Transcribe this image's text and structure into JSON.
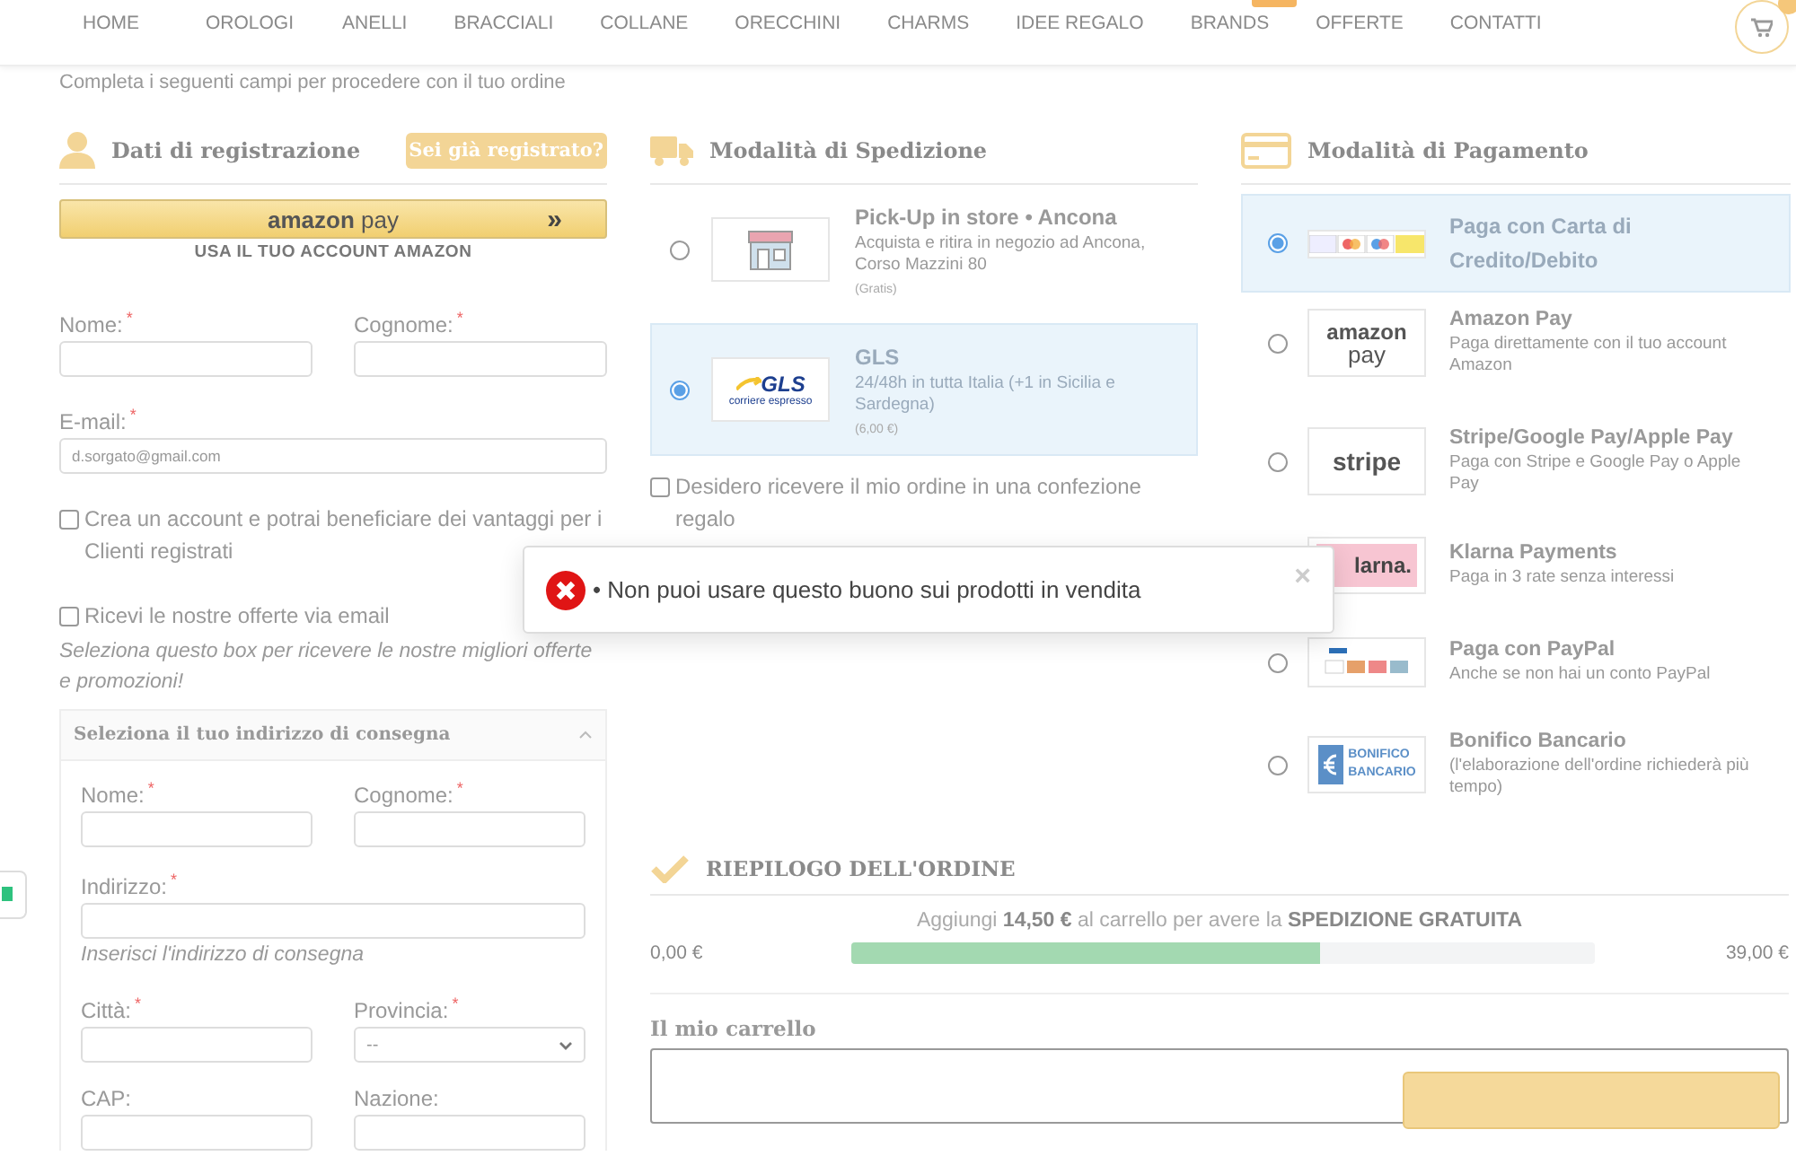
{
  "nav": {
    "items": [
      "HOME",
      "OROLOGI",
      "ANELLI",
      "BRACCIALI",
      "COLLANE",
      "ORECCHINI",
      "CHARMS",
      "IDEE REGALO",
      "BRANDS",
      "OFFERTE",
      "CONTATTI"
    ]
  },
  "intro": "Completa i seguenti campi per procedere con il tuo ordine",
  "registration": {
    "title": "Dati di registrazione",
    "login_button": "Sei già registrato?",
    "amazon_pay": {
      "logo": [
        "amazon",
        "pay"
      ],
      "arrow": "»",
      "caption": "USA IL TUO ACCOUNT AMAZON"
    },
    "rows": [
      [
        {
          "label": "Nome:",
          "mark": "*"
        },
        {
          "label": "Cognome:",
          "mark": "*"
        }
      ],
      [
        {
          "label": "E-mail:",
          "mark": "*",
          "value": "d.sorgato@gmail.com"
        }
      ]
    ],
    "options": [
      {
        "label": "Crea un account e potrai beneficiare dei vantaggi per i Clienti registrati",
        "checked": false
      },
      {
        "label": "Ricevi le nostre offerte via email",
        "checked": false,
        "hint": "Seleziona questo box per ricevere le nostre migliori offerte e promozioni!"
      }
    ]
  },
  "address": {
    "title": "Seleziona il tuo indirizzo di consegna",
    "expanded": true,
    "rows": [
      [
        {
          "label": "Nome:",
          "mark": "*"
        },
        {
          "label": "Cognome:",
          "mark": "*"
        }
      ],
      [
        {
          "label": "Indirizzo:",
          "mark": "*",
          "hint": "Inserisci l'indirizzo di consegna"
        }
      ],
      [
        {
          "label": "Città:",
          "mark": "*"
        },
        {
          "label": "Provincia:",
          "mark": "*",
          "kind": "select",
          "value": "--"
        }
      ],
      [
        {
          "label": "CAP:"
        },
        {
          "label": "Nazione:"
        }
      ]
    ]
  },
  "shipping": {
    "title": "Modalità di Spedizione",
    "options": [
      {
        "kind": "store",
        "name": "Pick-Up in store • Ancona",
        "description": "Acquista e ritira in negozio ad Ancona, Corso Mazzini 80",
        "price": "(Gratis)",
        "selected": false
      },
      {
        "kind": "gls",
        "logo_text": [
          "GLS",
          "corriere espresso"
        ],
        "name": "GLS",
        "description": "24/48h in tutta Italia (+1 in Sicilia e Sardegna)",
        "price": "(6,00 €)",
        "selected": true
      }
    ],
    "gift": {
      "label": "Desidero ricevere il mio ordine in una confezione regalo",
      "checked": false
    }
  },
  "payment": {
    "title": "Modalità di Pagamento",
    "options": [
      {
        "kind": "cards",
        "name": "Paga con Carta di Credito/Debito",
        "selected": true
      },
      {
        "kind": "amazon",
        "logo_text": [
          "amazon",
          "pay"
        ],
        "name": "Amazon Pay",
        "description": "Paga direttamente con il tuo account Amazon",
        "selected": false
      },
      {
        "kind": "stripe",
        "logo_text": [
          "stripe"
        ],
        "name": "Stripe/Google Pay/Apple Pay",
        "description": "Paga con Stripe e Google Pay o Apple Pay",
        "selected": false
      },
      {
        "kind": "klarna",
        "logo_text": [
          "larna."
        ],
        "name": "Klarna Payments",
        "description": "Paga in 3 rate senza interessi"
      },
      {
        "kind": "paypal",
        "name": "Paga con PayPal",
        "description": "Anche se non hai un conto PayPal",
        "selected": false
      },
      {
        "kind": "bank",
        "logo_text": [
          "BONIFICO",
          "BANCARIO"
        ],
        "name": "Bonifico Bancario",
        "description": "(l'elaborazione dell'ordine richiederà più tempo)",
        "selected": false
      }
    ]
  },
  "summary": {
    "title": "RIEPILOGO DELL'ORDINE",
    "free_shipping": "Aggiungi **14,50 €** al carrello per avere la **SPEDIZIONE GRATUITA**",
    "progress": {
      "min": "0,00 €",
      "max": "39,00 €",
      "level": 0.63
    },
    "cart_title": "Il mio carrello"
  },
  "toast": {
    "message": "• Non puoi usare questo buono sui prodotti in vendita",
    "close": "×"
  }
}
